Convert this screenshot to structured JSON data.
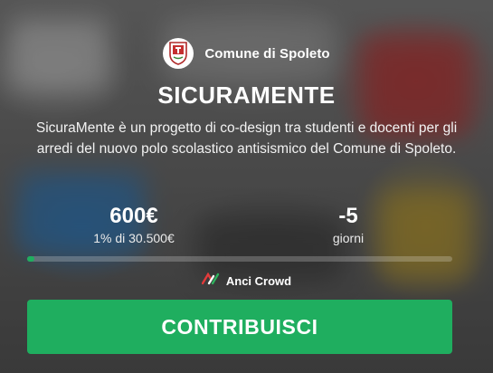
{
  "brand": {
    "name": "Comune di Spoleto",
    "logo_icon": "city-crest-icon"
  },
  "project": {
    "title": "SICURAMENTE",
    "description": "SicuraMente è un progetto di co-design tra studenti e docenti per gli arredi del nuovo polo scolastico antisismico del Comune di Spoleto."
  },
  "stats": {
    "raised": "600€",
    "progress_text": "1% di 30.500€",
    "days_value": "-5",
    "days_label": "giorni"
  },
  "progress": {
    "percent": 1,
    "fill_color": "#1fae5f"
  },
  "platform": {
    "name": "Anci Crowd",
    "icon": "anci-crowd-logo-icon"
  },
  "cta": {
    "label": "CONTRIBUISCI",
    "color": "#1fae5f"
  }
}
